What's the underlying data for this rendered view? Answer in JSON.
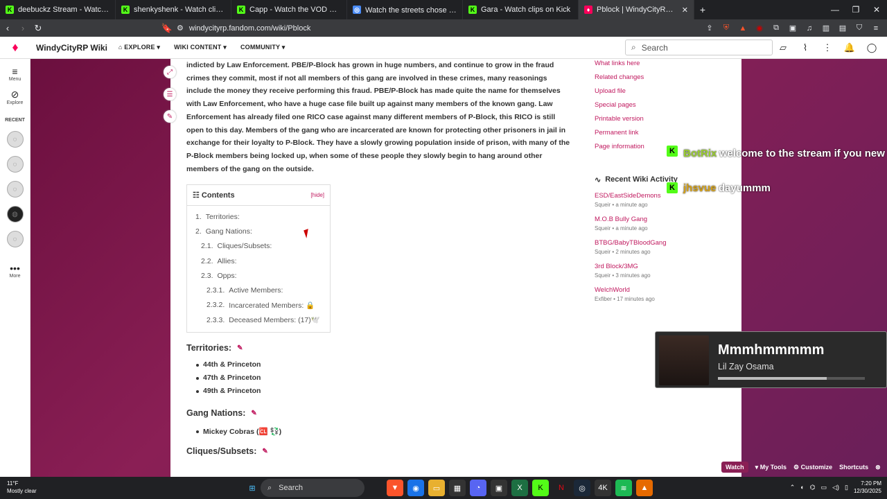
{
  "browser": {
    "tabs": [
      {
        "title": "deebuckz Stream - Watch Live on Kick",
        "icon": "kick-icon"
      },
      {
        "title": "shenkyshenk - Watch clips on Kick",
        "icon": "kick-icon"
      },
      {
        "title": "Capp - Watch the VOD on Kick",
        "icon": "kick-icon"
      },
      {
        "title": "Watch the streets chose me🎥 — sos...",
        "icon": "globe-icon"
      },
      {
        "title": "Gara - Watch clips on Kick",
        "icon": "kick-icon"
      },
      {
        "title": "Pblock | WindyCityRP Wiki | Fand...",
        "icon": "fandom-icon",
        "active": true
      }
    ],
    "url": "windycityrp.fandom.com/wiki/Pblock"
  },
  "wiki_header": {
    "site_name": "WindyCityRP Wiki",
    "nav": [
      "EXPLORE",
      "WIKI CONTENT",
      "COMMUNITY"
    ],
    "search_placeholder": "Search"
  },
  "left_rail": {
    "menu": "Menu",
    "explore": "Explore",
    "recent": "RECENT",
    "more": "More"
  },
  "article": {
    "paragraph": "indicted by Law Enforcement. PBE/P-Block has grown in huge numbers, and continue to grow in the fraud crimes they commit, most if not all members of this gang are involved in these crimes, many reasonings include the money they receive performing this fraud. PBE/P-Block has made quite the name for themselves with Law Enforcement, who have a huge case file built up against many members of the known gang. Law Enforcement has already filed one RICO case against many different members of P-Block, this RICO is still open to this day. Members of the gang who are incarcerated are known for protecting other prisoners in jail in exchange for their loyalty to P-Block. They have a slowly growing population inside of prison, with many of the P-Block members being locked up, when some of these people they slowly begin to hang around other members of the gang on the outside.",
    "toc": {
      "title": "Contents",
      "hide": "[hide]",
      "items": [
        {
          "num": "1.",
          "label": "Territories:",
          "level": 0
        },
        {
          "num": "2.",
          "label": "Gang Nations:",
          "level": 0
        },
        {
          "num": "2.1.",
          "label": "Cliques/Subsets:",
          "level": 1
        },
        {
          "num": "2.2.",
          "label": "Allies:",
          "level": 1
        },
        {
          "num": "2.3.",
          "label": "Opps:",
          "level": 1
        },
        {
          "num": "2.3.1.",
          "label": "Active Members:",
          "level": 2
        },
        {
          "num": "2.3.2.",
          "label": "Incarcerated Members: 🔒",
          "level": 2
        },
        {
          "num": "2.3.3.",
          "label": "Deceased Members: (17)🕊️",
          "level": 2
        }
      ]
    },
    "territories_heading": "Territories:",
    "territories": [
      "44th & Princeton",
      "47th & Princeton",
      "49th & Princeton"
    ],
    "gang_nations_heading": "Gang Nations:",
    "gang_nations": [
      "Mickey Cobras (🆑 💱)"
    ],
    "cliques_heading": "Cliques/Subsets:"
  },
  "right_rail": {
    "links": [
      "What links here",
      "Related changes",
      "Upload file",
      "Special pages",
      "Printable version",
      "Permanent link",
      "Page information"
    ],
    "activity_title": "Recent Wiki Activity",
    "activity": [
      {
        "page": "ESD/EastSideDemons",
        "meta": "Squeir • a minute ago"
      },
      {
        "page": "M.O.B Bully Gang",
        "meta": "Squeir • a minute ago"
      },
      {
        "page": "BTBG/BabyTBloodGang",
        "meta": "Squeir • 2 minutes ago"
      },
      {
        "page": "3rd Block/3MG",
        "meta": "Squeir • 3 minutes ago"
      },
      {
        "page": "WelchWorld",
        "meta": "Exfiber • 17 minutes ago"
      }
    ]
  },
  "chat": {
    "messages": [
      {
        "user": "BotRix",
        "text": "welcome to the stream if you new",
        "color": "#9acd32"
      },
      {
        "user": "jhsvue",
        "text": "dayummm",
        "color": "#d4a017"
      }
    ]
  },
  "now_playing": {
    "title": "Mmmhmmmmm",
    "artist": "Lil Zay Osama",
    "progress": 0.74
  },
  "wiki_footer": {
    "watch": "Watch",
    "my_tools": "My Tools",
    "customize": "Customize",
    "shortcuts": "Shortcuts"
  },
  "taskbar": {
    "weather_temp": "11°F",
    "weather_desc": "Mostly clear",
    "search": "Search",
    "time": "7:20 PM",
    "date": "12/30/2025"
  },
  "colors": {
    "accent": "#c0185e",
    "kick_green": "#53fc18",
    "page_bg": "#6b0f3e"
  }
}
